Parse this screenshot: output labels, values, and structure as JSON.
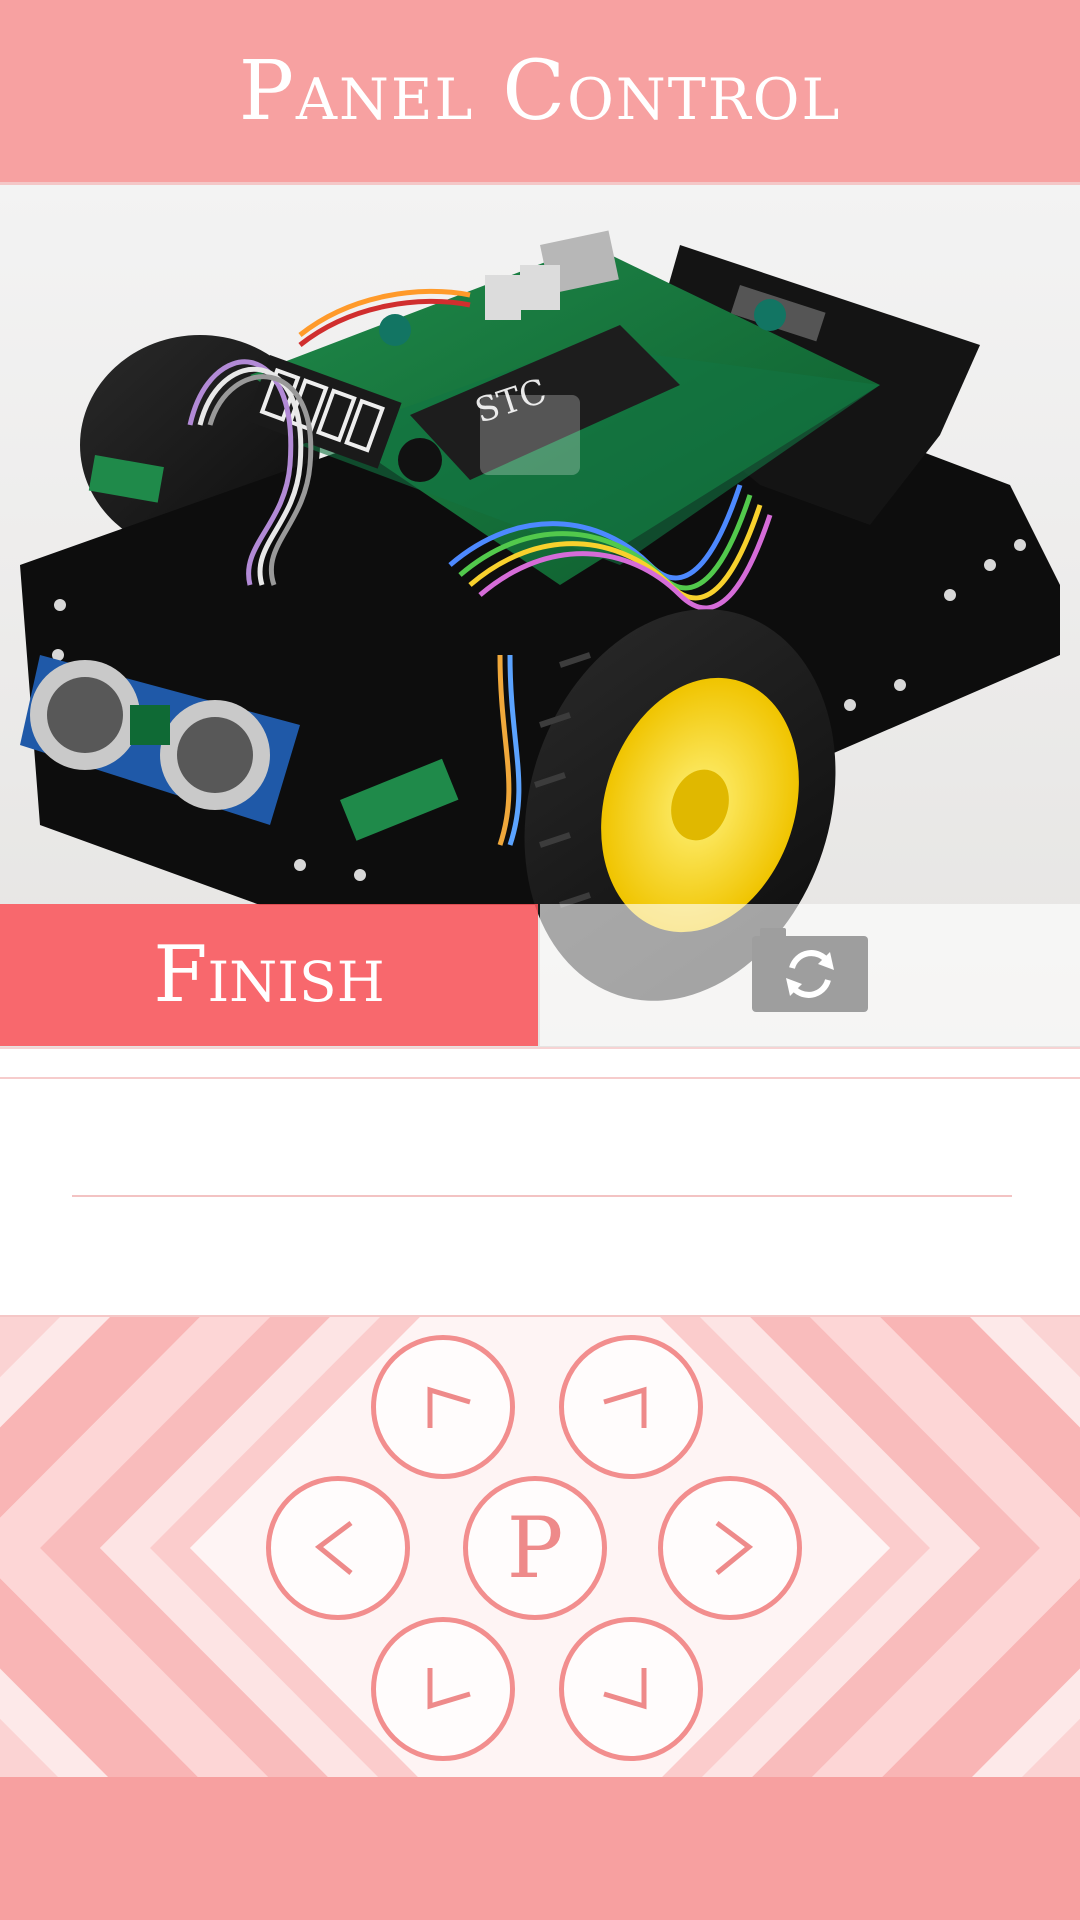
{
  "header": {
    "title": "Panel Control"
  },
  "camera": {
    "finish_label": "Finish",
    "switch_icon": "camera-switch-icon",
    "chip_label": "STC"
  },
  "controls": {
    "center_label": "P",
    "icons": [
      "forward-left-arrow-icon",
      "forward-right-arrow-icon",
      "left-arrow-icon",
      "right-arrow-icon",
      "back-left-arrow-icon",
      "back-right-arrow-icon"
    ]
  },
  "colors": {
    "accent": "#f7a1a1",
    "finish": "#fa565c",
    "button_ring": "#f28e8e"
  }
}
